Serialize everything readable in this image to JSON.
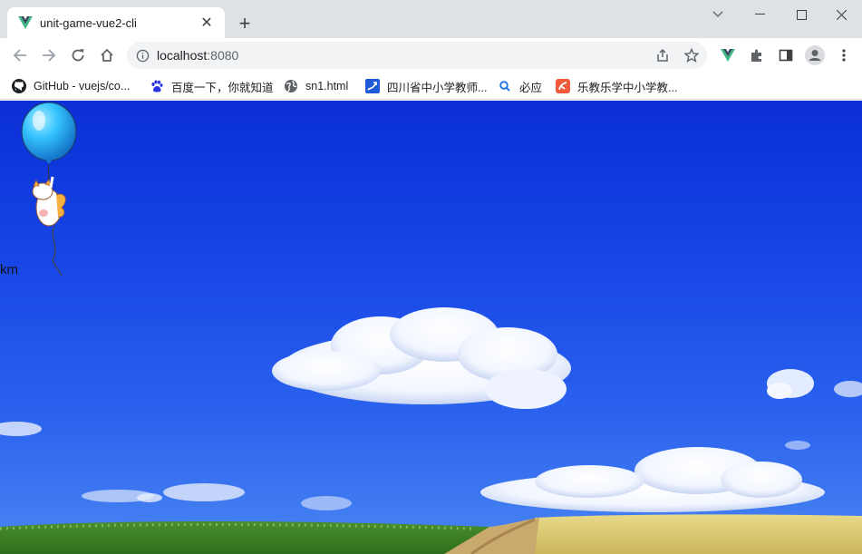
{
  "browser": {
    "tab": {
      "title": "unit-game-vue2-cli",
      "close_glyph": "✕"
    },
    "new_tab_glyph": "+",
    "address": {
      "host": "localhost",
      "port": ":8080"
    }
  },
  "bookmarks": [
    {
      "label": "GitHub - vuejs/co...",
      "icon": "github-icon"
    },
    {
      "label": "百度一下，你就知道",
      "icon": "baidu-paw-icon"
    },
    {
      "label": "sn1.html",
      "icon": "globe-icon"
    },
    {
      "label": "四川省中小学教师...",
      "icon": "site-logo-icon"
    },
    {
      "label": "必应",
      "icon": "bing-search-icon"
    },
    {
      "label": "乐教乐学中小学教...",
      "icon": "lejiao-icon"
    }
  ],
  "game": {
    "distance_label": "km"
  },
  "colors": {
    "sky_top": "#0a2fd6",
    "balloon": "#35c3ff",
    "vue_green": "#41b883"
  }
}
